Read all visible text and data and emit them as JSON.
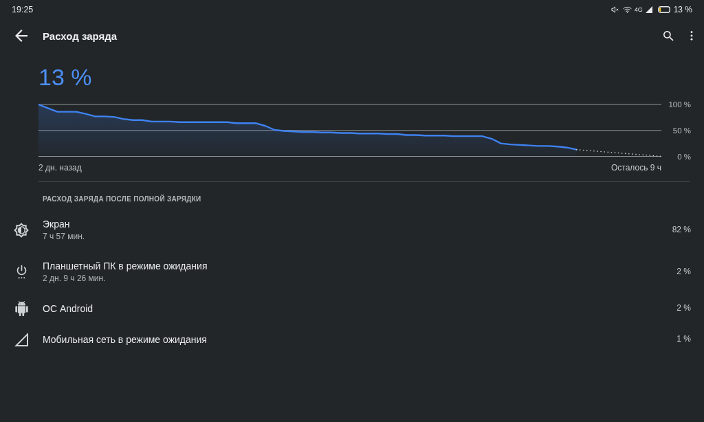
{
  "status_bar": {
    "time": "19:25",
    "network_type": "4G",
    "battery_percent": "13 %"
  },
  "app_bar": {
    "title": "Расход заряда"
  },
  "battery": {
    "level_text": "13 %",
    "chart_data": {
      "type": "area",
      "categories": [
        null,
        null,
        null,
        null,
        null,
        null,
        null,
        null,
        null,
        null,
        null,
        null,
        null,
        null,
        null,
        null,
        null,
        null,
        null,
        null,
        null,
        null,
        null,
        null,
        null,
        null,
        null,
        null,
        null,
        null,
        null,
        null,
        null,
        null,
        null,
        null,
        null,
        null,
        null,
        null,
        null,
        null,
        null,
        null,
        null,
        null,
        null,
        null,
        null,
        null,
        null,
        null,
        null,
        null,
        null,
        null,
        null,
        null,
        null,
        null,
        null,
        null,
        null,
        null,
        null,
        null,
        null
      ],
      "series": [
        {
          "color": "#3f82f2",
          "values": [
            100,
            93,
            86,
            86,
            86,
            82,
            77,
            77,
            76,
            72,
            70,
            70,
            67,
            67,
            67,
            66,
            66,
            66,
            66,
            66,
            66,
            64,
            64,
            64,
            59,
            51,
            49,
            48,
            47,
            47,
            46,
            46,
            45,
            45,
            44,
            44,
            44,
            43,
            43,
            41,
            41,
            40,
            40,
            40,
            39,
            39,
            39,
            39,
            34,
            25,
            23,
            22,
            21,
            20,
            20,
            19,
            17,
            13,
            null,
            null,
            null,
            null,
            null,
            null,
            null,
            null,
            null
          ]
        }
      ],
      "ylim": [
        0,
        100
      ],
      "yticks": [
        {
          "value": 0,
          "label": "0 %"
        },
        {
          "value": 50,
          "label": "50 %"
        },
        {
          "value": 100,
          "label": "100 %"
        }
      ]
    },
    "forecast_shown": true,
    "range_start": "2 дн. назад",
    "time_left": "Осталось 9 ч"
  },
  "usage": {
    "header": "РАСХОД ЗАРЯДА ПОСЛЕ ПОЛНОЙ ЗАРЯДКИ",
    "items": [
      {
        "kind": "screen",
        "title": "Экран",
        "subtitle": "7 ч 57 мин.",
        "percent": "82 %"
      },
      {
        "kind": "standby",
        "title": "Планшетный ПК в режиме ожидания",
        "subtitle": "2 дн. 9 ч 26 мин.",
        "percent": "2 %"
      },
      {
        "kind": "system",
        "title": "ОС Android",
        "percent": "2 %"
      },
      {
        "kind": "cell_standby",
        "title": "Мобильная сеть в режиме ожидания",
        "percent": "1 %"
      }
    ]
  }
}
